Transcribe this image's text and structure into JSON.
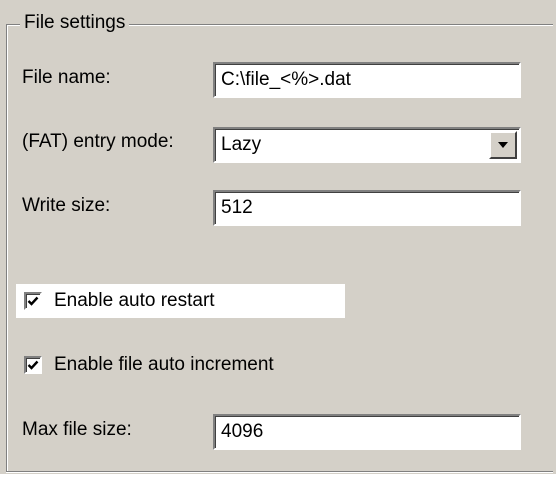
{
  "group": {
    "title": "File settings"
  },
  "fields": {
    "file_name": {
      "label": "File name:",
      "value": "C:\\file_<%>.dat"
    },
    "fat_entry_mode": {
      "label": "(FAT) entry mode:",
      "value": "Lazy"
    },
    "write_size": {
      "label": "Write size:",
      "value": "512"
    },
    "max_file_size": {
      "label": "Max file size:",
      "value": "4096"
    }
  },
  "checkboxes": {
    "auto_restart": {
      "label": "Enable auto restart",
      "checked": true
    },
    "auto_increment": {
      "label": "Enable file auto increment",
      "checked": true
    }
  },
  "icons": {
    "combo_arrow": "chevron-down-icon",
    "check": "checkmark-icon"
  },
  "colors": {
    "face": "#d4d0c8",
    "shadow": "#808080",
    "highlight": "#ffffff"
  }
}
